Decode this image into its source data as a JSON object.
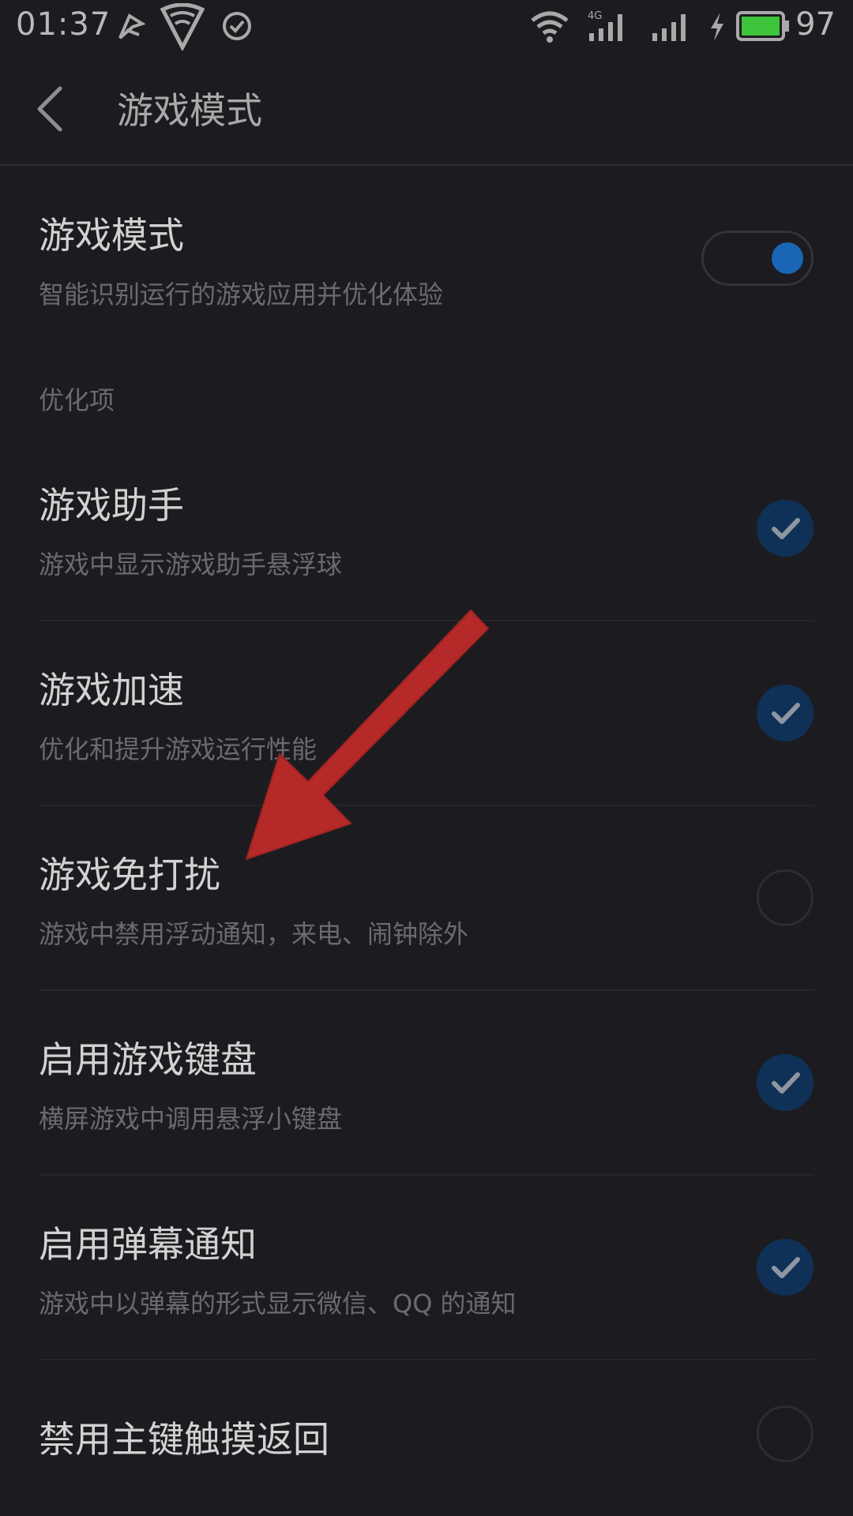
{
  "status_bar": {
    "time": "01:37",
    "battery_level": "97",
    "icons": [
      "flag-icon",
      "shield-wifi-icon",
      "check-circle-icon",
      "wifi-icon",
      "4g-signal-icon",
      "signal-icon",
      "charging-icon",
      "battery-icon"
    ],
    "network_label": "4G"
  },
  "app_bar": {
    "title": "游戏模式"
  },
  "game_mode": {
    "title": "游戏模式",
    "subtitle": "智能识别运行的游戏应用并优化体验",
    "enabled": true
  },
  "section_header": "优化项",
  "settings": [
    {
      "title": "游戏助手",
      "subtitle": "游戏中显示游戏助手悬浮球",
      "checked": true
    },
    {
      "title": "游戏加速",
      "subtitle": "优化和提升游戏运行性能",
      "checked": true
    },
    {
      "title": "游戏免打扰",
      "subtitle": "游戏中禁用浮动通知，来电、闹钟除外",
      "checked": false
    },
    {
      "title": "启用游戏键盘",
      "subtitle": "横屏游戏中调用悬浮小键盘",
      "checked": true
    },
    {
      "title": "启用弹幕通知",
      "subtitle": "游戏中以弹幕的形式显示微信、QQ 的通知",
      "checked": true
    },
    {
      "title": "禁用主键触摸返回",
      "subtitle": "",
      "checked": false
    }
  ],
  "colors": {
    "background": "#1c1c20",
    "accent": "#1a66b4",
    "check_bg": "#0f3157",
    "annotation_arrow": "#b52a28"
  }
}
